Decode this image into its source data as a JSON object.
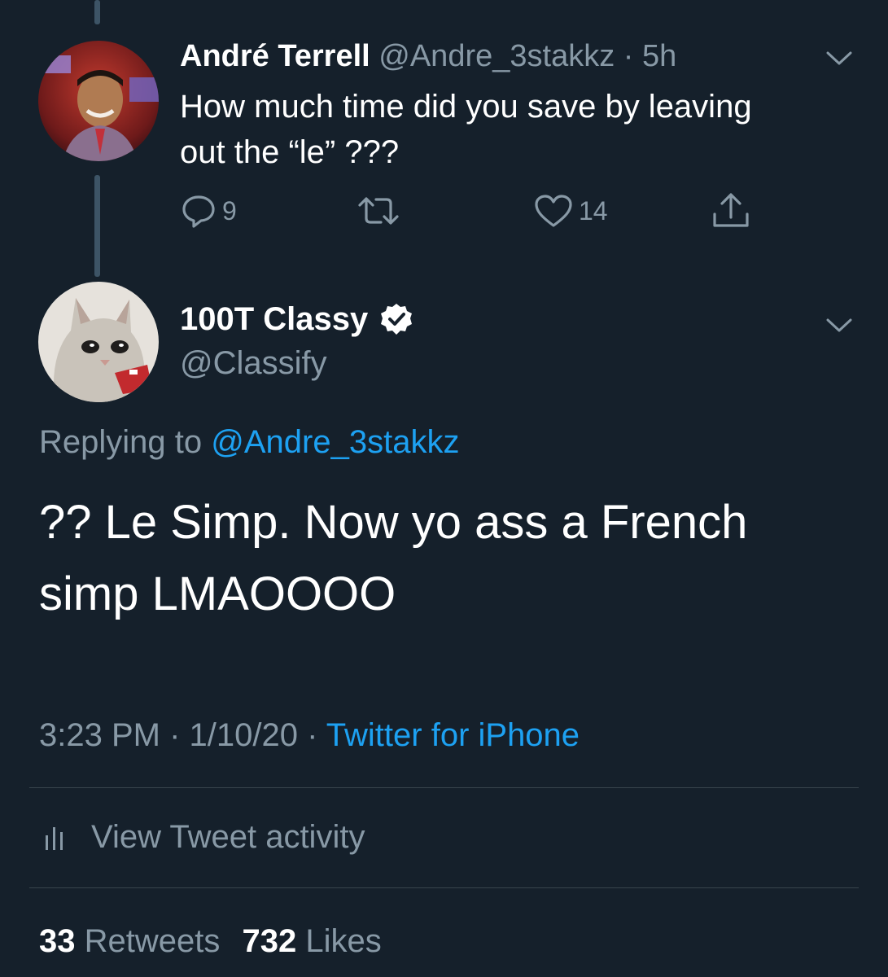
{
  "parent_tweet": {
    "author_name": "André Terrell",
    "handle_time": "@Andre_3stakkz · 5h",
    "text_line1": "How much time did you save by leaving",
    "text_line2": "out the “le” ???",
    "reply_count": "9",
    "like_count": "14"
  },
  "main_tweet": {
    "author_name": "100T Classy",
    "handle": "@Classify",
    "replying_prefix": "Replying to",
    "replying_handle": "@Andre_3stakkz",
    "text_line1": "?? Le Simp. Now yo ass a French",
    "text_line2": "simp LMAOOOO",
    "time_date": "3:23 PM · 1/10/20 ·",
    "source": "Twitter for iPhone",
    "activity_label": "View Tweet activity",
    "retweet_count": "33",
    "retweet_label": "Retweets",
    "like_count": "732",
    "like_label": "Likes"
  },
  "icons": {
    "reply": "reply-bubble-icon",
    "retweet": "retweet-arrows-icon",
    "like": "heart-icon",
    "share": "share-upload-icon",
    "verified": "verified-badge-icon",
    "menu": "chevron-down-icon",
    "activity": "bar-chart-icon"
  },
  "colors": {
    "background": "#15202b",
    "text": "#ffffff",
    "muted": "#8899a6",
    "accent": "#1da1f2",
    "divider": "#38444d",
    "thread_line": "#3d5466"
  }
}
